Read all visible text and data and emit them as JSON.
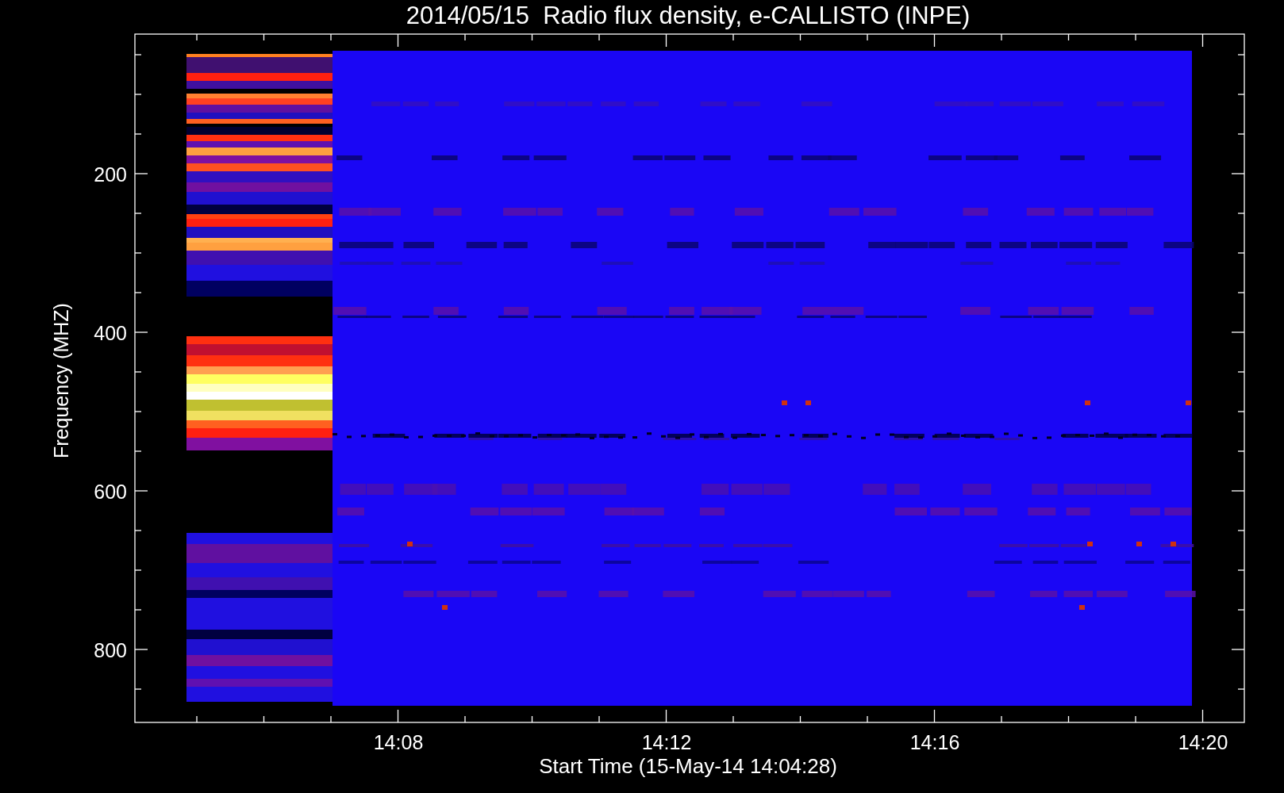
{
  "title": "2014/05/15  Radio flux density, e-CALLISTO (INPE)",
  "y_axis": {
    "label": "Frequency (MHZ)",
    "ticks": [
      "200",
      "400",
      "600",
      "800"
    ]
  },
  "x_axis": {
    "label": "Start Time (15-May-14 14:04:28)",
    "ticks": [
      "14:08",
      "14:12",
      "14:16",
      "14:20"
    ]
  }
}
